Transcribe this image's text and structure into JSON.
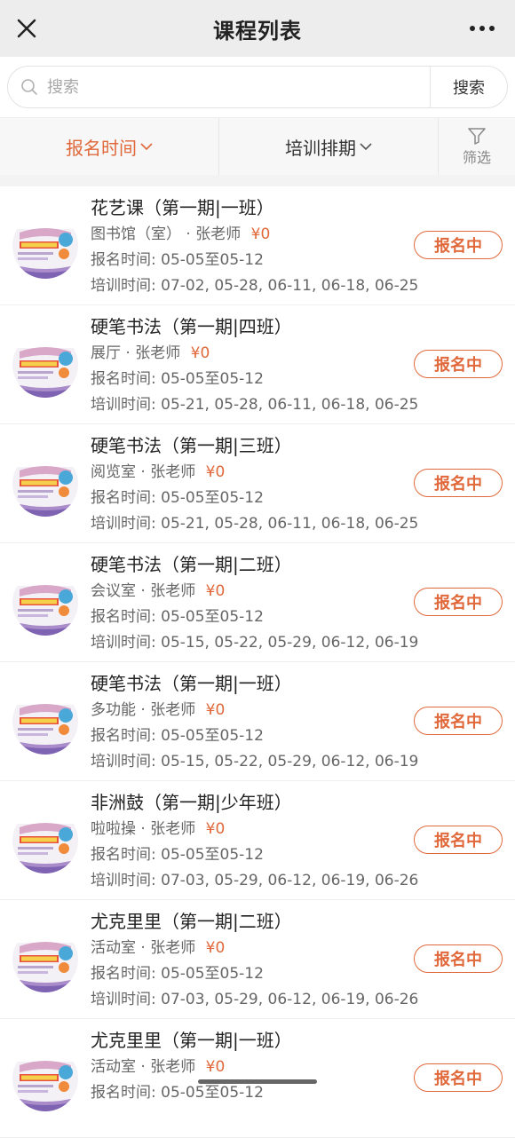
{
  "header": {
    "title": "课程列表",
    "close_icon": "close-icon",
    "more_icon": "more-dots-icon"
  },
  "search": {
    "placeholder": "搜索",
    "button_label": "搜索",
    "icon": "search-icon"
  },
  "filters": {
    "tab_signup": "报名时间",
    "tab_training": "培训排期",
    "filter_label": "筛选",
    "active_color": "#e0683a"
  },
  "courses": [
    {
      "name": "花艺课（第一期|一班）",
      "location": "图书馆（室）",
      "teacher": "张老师",
      "price": "¥0",
      "signup": "报名时间:  05-05至05-12",
      "training": "培训时间:  07-02, 05-28, 06-11, 06-18, 06-25",
      "status": "报名中"
    },
    {
      "name": "硬笔书法（第一期|四班）",
      "location": "展厅",
      "teacher": "张老师",
      "price": "¥0",
      "signup": "报名时间:  05-05至05-12",
      "training": "培训时间:  05-21, 05-28, 06-11, 06-18, 06-25",
      "status": "报名中"
    },
    {
      "name": "硬笔书法（第一期|三班）",
      "location": "阅览室",
      "teacher": "张老师",
      "price": "¥0",
      "signup": "报名时间:  05-05至05-12",
      "training": "培训时间:  05-21, 05-28, 06-11, 06-18, 06-25",
      "status": "报名中"
    },
    {
      "name": "硬笔书法（第一期|二班）",
      "location": "会议室",
      "teacher": "张老师",
      "price": "¥0",
      "signup": "报名时间:  05-05至05-12",
      "training": "培训时间:  05-15, 05-22, 05-29, 06-12, 06-19",
      "status": "报名中"
    },
    {
      "name": "硬笔书法（第一期|一班）",
      "location": "多功能",
      "teacher": "张老师",
      "price": "¥0",
      "signup": "报名时间:  05-05至05-12",
      "training": "培训时间:  05-15, 05-22, 05-29, 06-12, 06-19",
      "status": "报名中"
    },
    {
      "name": "非洲鼓（第一期|少年班）",
      "location": "啦啦操",
      "teacher": "张老师",
      "price": "¥0",
      "signup": "报名时间:  05-05至05-12",
      "training": "培训时间:  07-03, 05-29, 06-12, 06-19, 06-26",
      "status": "报名中"
    },
    {
      "name": "尤克里里（第一期|二班）",
      "location": "活动室",
      "teacher": "张老师",
      "price": "¥0",
      "signup": "报名时间:  05-05至05-12",
      "training": "培训时间:  07-03, 05-29, 06-12, 06-19, 06-26",
      "status": "报名中"
    },
    {
      "name": "尤克里里（第一期|一班）",
      "location": "活动室",
      "teacher": "张老师",
      "price": "¥0",
      "signup": "报名时间:  05-05至05-12",
      "training": "",
      "status": "报名中"
    }
  ]
}
